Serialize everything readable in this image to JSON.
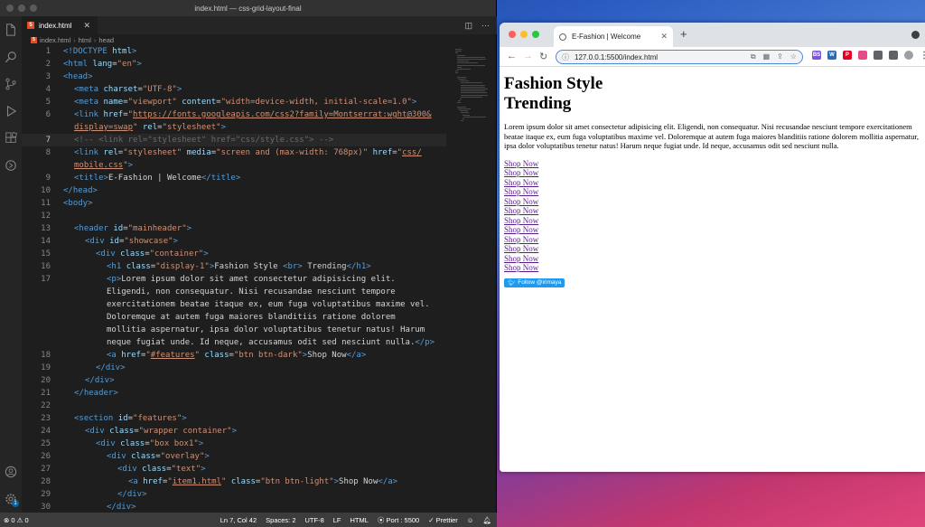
{
  "vscode": {
    "window_title": "index.html — css-grid-layout-final",
    "tab": {
      "label": "index.html",
      "icon": "html5-file-icon"
    },
    "breadcrumb": [
      "index.html",
      "html",
      "head"
    ],
    "status": {
      "errors": "0",
      "warnings": "0",
      "cursor": "Ln 7, Col 42",
      "spaces": "Spaces: 2",
      "encoding": "UTF-8",
      "eol": "LF",
      "language": "HTML",
      "port": "Port : 5500",
      "prettier": "Prettier"
    },
    "lines": [
      {
        "ln": "1",
        "indent": 0,
        "tokens": [
          [
            "tag",
            "<!DOCTYPE "
          ],
          [
            "attr",
            "html"
          ],
          [
            "tag",
            ">"
          ]
        ]
      },
      {
        "ln": "2",
        "indent": 0,
        "tokens": [
          [
            "tag",
            "<html "
          ],
          [
            "attr",
            "lang"
          ],
          [
            "txt",
            "="
          ],
          [
            "str",
            "\"en\""
          ],
          [
            "tag",
            ">"
          ]
        ]
      },
      {
        "ln": "3",
        "indent": 0,
        "tokens": [
          [
            "tag",
            "<head>"
          ]
        ]
      },
      {
        "ln": "4",
        "indent": 1,
        "tokens": [
          [
            "tag",
            "<meta "
          ],
          [
            "attr",
            "charset"
          ],
          [
            "txt",
            "="
          ],
          [
            "str",
            "\"UTF-8\""
          ],
          [
            "tag",
            ">"
          ]
        ]
      },
      {
        "ln": "5",
        "indent": 1,
        "tokens": [
          [
            "tag",
            "<meta "
          ],
          [
            "attr",
            "name"
          ],
          [
            "txt",
            "="
          ],
          [
            "str",
            "\"viewport\" "
          ],
          [
            "attr",
            "content"
          ],
          [
            "txt",
            "="
          ],
          [
            "str",
            "\"width=device-width, initial-scale=1.0\""
          ],
          [
            "tag",
            ">"
          ]
        ]
      },
      {
        "ln": "6",
        "indent": 1,
        "tokens": [
          [
            "tag",
            "<link "
          ],
          [
            "attr",
            "href"
          ],
          [
            "txt",
            "="
          ],
          [
            "str",
            "\""
          ],
          [
            "link",
            "https://fonts.googleapis.com/css2?family=Montserrat:wght@300&"
          ]
        ]
      },
      {
        "ln": "",
        "indent": 1,
        "tokens": [
          [
            "link",
            "display=swap"
          ],
          [
            "str",
            "\" "
          ],
          [
            "attr",
            "rel"
          ],
          [
            "txt",
            "="
          ],
          [
            "str",
            "\"stylesheet\""
          ],
          [
            "tag",
            ">"
          ]
        ]
      },
      {
        "ln": "7",
        "indent": 1,
        "active": true,
        "tokens": [
          [
            "com",
            "<!-- <link rel=\"stylesheet\" href=\"css/style.css\"> -->"
          ]
        ]
      },
      {
        "ln": "8",
        "indent": 1,
        "tokens": [
          [
            "tag",
            "<link "
          ],
          [
            "attr",
            "rel"
          ],
          [
            "txt",
            "="
          ],
          [
            "str",
            "\"stylesheet\" "
          ],
          [
            "attr",
            "media"
          ],
          [
            "txt",
            "="
          ],
          [
            "str",
            "\"screen and (max-width: 768px)\" "
          ],
          [
            "attr",
            "href"
          ],
          [
            "txt",
            "="
          ],
          [
            "str",
            "\""
          ],
          [
            "link",
            "css/"
          ]
        ]
      },
      {
        "ln": "",
        "indent": 1,
        "tokens": [
          [
            "link",
            "mobile.css"
          ],
          [
            "str",
            "\""
          ],
          [
            "tag",
            ">"
          ]
        ]
      },
      {
        "ln": "9",
        "indent": 1,
        "tokens": [
          [
            "tag",
            "<title>"
          ],
          [
            "txt",
            "E-Fashion | Welcome"
          ],
          [
            "tag",
            "</title>"
          ]
        ]
      },
      {
        "ln": "10",
        "indent": 0,
        "tokens": [
          [
            "tag",
            "</head>"
          ]
        ]
      },
      {
        "ln": "11",
        "indent": 0,
        "tokens": [
          [
            "tag",
            "<body>"
          ]
        ]
      },
      {
        "ln": "12",
        "indent": 0,
        "tokens": []
      },
      {
        "ln": "13",
        "indent": 1,
        "tokens": [
          [
            "tag",
            "<header "
          ],
          [
            "attr",
            "id"
          ],
          [
            "txt",
            "="
          ],
          [
            "str",
            "\"mainheader\""
          ],
          [
            "tag",
            ">"
          ]
        ]
      },
      {
        "ln": "14",
        "indent": 2,
        "tokens": [
          [
            "tag",
            "<div "
          ],
          [
            "attr",
            "id"
          ],
          [
            "txt",
            "="
          ],
          [
            "str",
            "\"showcase\""
          ],
          [
            "tag",
            ">"
          ]
        ]
      },
      {
        "ln": "15",
        "indent": 3,
        "tokens": [
          [
            "tag",
            "<div "
          ],
          [
            "attr",
            "class"
          ],
          [
            "txt",
            "="
          ],
          [
            "str",
            "\"container\""
          ],
          [
            "tag",
            ">"
          ]
        ]
      },
      {
        "ln": "16",
        "indent": 4,
        "tokens": [
          [
            "tag",
            "<h1 "
          ],
          [
            "attr",
            "class"
          ],
          [
            "txt",
            "="
          ],
          [
            "str",
            "\"display-1\""
          ],
          [
            "tag",
            ">"
          ],
          [
            "txt",
            "Fashion Style "
          ],
          [
            "tag",
            "<br>"
          ],
          [
            "txt",
            " Trending"
          ],
          [
            "tag",
            "</h1>"
          ]
        ]
      },
      {
        "ln": "17",
        "indent": 4,
        "tokens": [
          [
            "tag",
            "<p>"
          ],
          [
            "txt",
            "Lorem ipsum dolor sit amet consectetur adipisicing elit."
          ]
        ]
      },
      {
        "ln": "",
        "indent": 4,
        "tokens": [
          [
            "txt",
            "Eligendi, non consequatur. Nisi recusandae nesciunt tempore"
          ]
        ]
      },
      {
        "ln": "",
        "indent": 4,
        "tokens": [
          [
            "txt",
            "exercitationem beatae itaque ex, eum fuga voluptatibus maxime vel."
          ]
        ]
      },
      {
        "ln": "",
        "indent": 4,
        "tokens": [
          [
            "txt",
            "Doloremque at autem fuga maiores blanditiis ratione dolorem"
          ]
        ]
      },
      {
        "ln": "",
        "indent": 4,
        "tokens": [
          [
            "txt",
            "mollitia aspernatur, ipsa dolor voluptatibus tenetur natus! Harum"
          ]
        ]
      },
      {
        "ln": "",
        "indent": 4,
        "tokens": [
          [
            "txt",
            "neque fugiat unde. Id neque, accusamus odit sed nesciunt nulla."
          ],
          [
            "tag",
            "</p>"
          ]
        ]
      },
      {
        "ln": "18",
        "indent": 4,
        "tokens": [
          [
            "tag",
            "<a "
          ],
          [
            "attr",
            "href"
          ],
          [
            "txt",
            "="
          ],
          [
            "str",
            "\""
          ],
          [
            "link",
            "#features"
          ],
          [
            "str",
            "\" "
          ],
          [
            "attr",
            "class"
          ],
          [
            "txt",
            "="
          ],
          [
            "str",
            "\"btn btn-dark\""
          ],
          [
            "tag",
            ">"
          ],
          [
            "txt",
            "Shop Now"
          ],
          [
            "tag",
            "</a>"
          ]
        ]
      },
      {
        "ln": "19",
        "indent": 3,
        "tokens": [
          [
            "tag",
            "</div>"
          ]
        ]
      },
      {
        "ln": "20",
        "indent": 2,
        "tokens": [
          [
            "tag",
            "</div>"
          ]
        ]
      },
      {
        "ln": "21",
        "indent": 1,
        "tokens": [
          [
            "tag",
            "</header>"
          ]
        ]
      },
      {
        "ln": "22",
        "indent": 0,
        "tokens": []
      },
      {
        "ln": "23",
        "indent": 1,
        "tokens": [
          [
            "tag",
            "<section "
          ],
          [
            "attr",
            "id"
          ],
          [
            "txt",
            "="
          ],
          [
            "str",
            "\"features\""
          ],
          [
            "tag",
            ">"
          ]
        ]
      },
      {
        "ln": "24",
        "indent": 2,
        "tokens": [
          [
            "tag",
            "<div "
          ],
          [
            "attr",
            "class"
          ],
          [
            "txt",
            "="
          ],
          [
            "str",
            "\"wrapper container\""
          ],
          [
            "tag",
            ">"
          ]
        ]
      },
      {
        "ln": "25",
        "indent": 3,
        "tokens": [
          [
            "tag",
            "<div "
          ],
          [
            "attr",
            "class"
          ],
          [
            "txt",
            "="
          ],
          [
            "str",
            "\"box box1\""
          ],
          [
            "tag",
            ">"
          ]
        ]
      },
      {
        "ln": "26",
        "indent": 4,
        "tokens": [
          [
            "tag",
            "<div "
          ],
          [
            "attr",
            "class"
          ],
          [
            "txt",
            "="
          ],
          [
            "str",
            "\"overlay\""
          ],
          [
            "tag",
            ">"
          ]
        ]
      },
      {
        "ln": "27",
        "indent": 5,
        "tokens": [
          [
            "tag",
            "<div "
          ],
          [
            "attr",
            "class"
          ],
          [
            "txt",
            "="
          ],
          [
            "str",
            "\"text\""
          ],
          [
            "tag",
            ">"
          ]
        ]
      },
      {
        "ln": "28",
        "indent": 6,
        "tokens": [
          [
            "tag",
            "<a "
          ],
          [
            "attr",
            "href"
          ],
          [
            "txt",
            "="
          ],
          [
            "str",
            "\""
          ],
          [
            "link",
            "item1.html"
          ],
          [
            "str",
            "\" "
          ],
          [
            "attr",
            "class"
          ],
          [
            "txt",
            "="
          ],
          [
            "str",
            "\"btn btn-light\""
          ],
          [
            "tag",
            ">"
          ],
          [
            "txt",
            "Shop Now"
          ],
          [
            "tag",
            "</a>"
          ]
        ]
      },
      {
        "ln": "29",
        "indent": 5,
        "tokens": [
          [
            "tag",
            "</div>"
          ]
        ]
      },
      {
        "ln": "30",
        "indent": 4,
        "tokens": [
          [
            "tag",
            "</div>"
          ]
        ]
      }
    ]
  },
  "browser": {
    "tab_title": "E-Fashion | Welcome",
    "url": "127.0.0.1:5500/index.html",
    "page": {
      "heading_line1": "Fashion Style",
      "heading_line2": "Trending",
      "paragraph": "Lorem ipsum dolor sit amet consectetur adipisicing elit. Eligendi, non consequatur. Nisi recusandae nesciunt tempore exercitationem beatae itaque ex, eum fuga voluptatibus maxime vel. Doloremque at autem fuga maiores blanditiis ratione dolorem mollitia aspernatur, ipsa dolor voluptatibus tenetur natus! Harum neque fugiat unde. Id neque, accusamus odit sed nesciunt nulla.",
      "shop_links": [
        "Shop Now",
        "Shop Now",
        "Shop Now",
        "Shop Now",
        "Shop Now",
        "Shop Now",
        "Shop Now",
        "Shop Now",
        "Shop Now",
        "Shop Now",
        "Shop Now",
        "Shop Now"
      ],
      "follow_button": "Follow @irimaya"
    },
    "extensions": [
      {
        "name": "extension-bs-icon",
        "color": "#7b57d6",
        "label": "BS"
      },
      {
        "name": "extension-w-icon",
        "color": "#2b6cb0",
        "label": "W"
      },
      {
        "name": "pinterest-icon",
        "color": "#e60023",
        "label": "P"
      },
      {
        "name": "extension-colorpick-icon",
        "color": "#e94b8a",
        "label": ""
      },
      {
        "name": "extension-puzzle-icon",
        "color": "#5f6368",
        "label": ""
      },
      {
        "name": "extension-shield-icon",
        "color": "#5f6368",
        "label": ""
      },
      {
        "name": "profile-icon",
        "color": "#9aa0a6",
        "label": ""
      },
      {
        "name": "menu-icon",
        "color": "#5f6368",
        "label": ""
      }
    ]
  },
  "colors": {
    "tag": "#569cd6",
    "attr": "#9cdcfe",
    "string": "#ce9178",
    "comment": "#6a6a6a",
    "visited_link": "#551a8b",
    "twitter": "#1d9bf0"
  }
}
